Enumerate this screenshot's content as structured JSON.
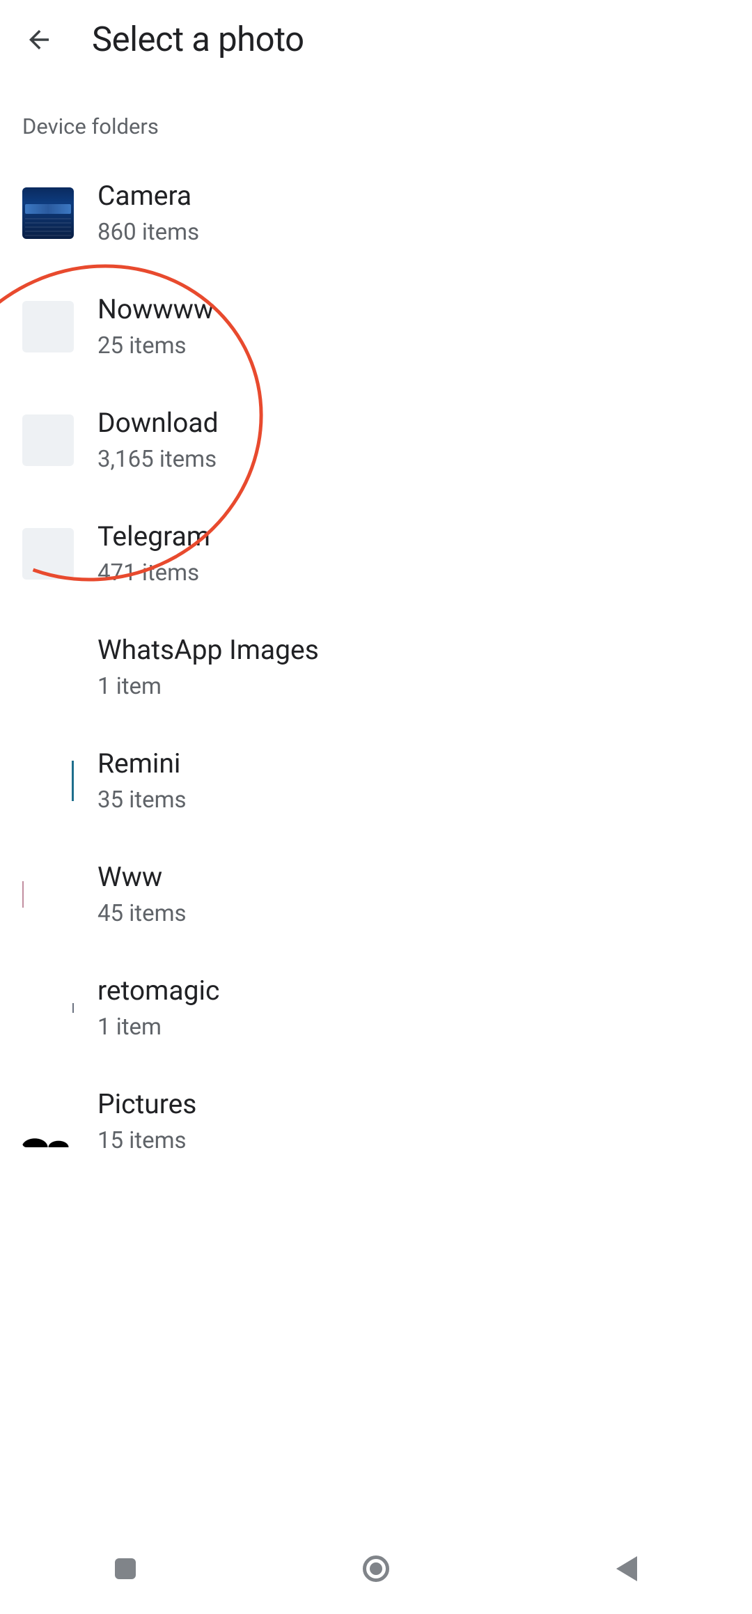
{
  "header": {
    "title": "Select a photo"
  },
  "section_label": "Device folders",
  "folders": [
    {
      "name": "Camera",
      "count": "860 items"
    },
    {
      "name": "Nowwww",
      "count": "25 items"
    },
    {
      "name": "Download",
      "count": "3,165 items"
    },
    {
      "name": "Telegram",
      "count": "471 items"
    },
    {
      "name": "WhatsApp Images",
      "count": "1 item"
    },
    {
      "name": "Remini",
      "count": "35 items"
    },
    {
      "name": "Www",
      "count": "45 items"
    },
    {
      "name": "retomagic",
      "count": "1 item"
    },
    {
      "name": "Pictures",
      "count": "15 items"
    }
  ]
}
